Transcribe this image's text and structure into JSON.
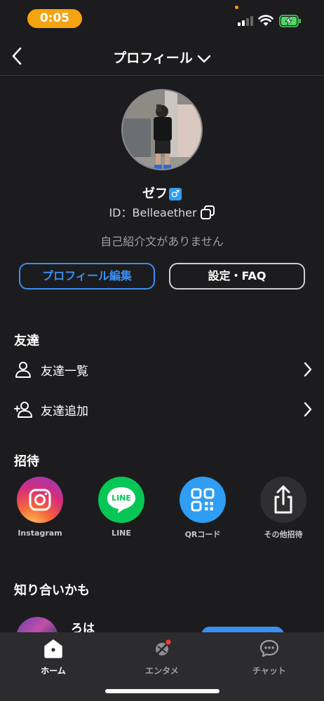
{
  "status_bar": {
    "time": "0:05"
  },
  "nav": {
    "title": "プロフィール"
  },
  "profile": {
    "name": "ゼフ",
    "gender_symbol": "♂",
    "id_text": "ID：Belleaether",
    "bio": "自己紹介文がありません",
    "edit_button": "プロフィール編集",
    "settings_button": "設定・FAQ"
  },
  "friends": {
    "title": "友達",
    "items": [
      {
        "label": "友達一覧",
        "icon": "person-icon"
      },
      {
        "label": "友達追加",
        "icon": "person-add-icon"
      }
    ]
  },
  "invite": {
    "title": "招待",
    "items": [
      {
        "label": "Instagram",
        "icon": "instagram-icon"
      },
      {
        "label": "LINE",
        "icon": "line-icon",
        "icon_text": "LINE"
      },
      {
        "label": "QRコード",
        "icon": "qr-code-icon"
      },
      {
        "label": "その他招待",
        "icon": "share-icon"
      }
    ]
  },
  "suggestions": {
    "title": "知り合いかも",
    "items": [
      {
        "name": "ろは"
      }
    ]
  },
  "tabbar": {
    "tabs": [
      {
        "label": "ホーム",
        "icon": "home-icon",
        "active": true
      },
      {
        "label": "エンタメ",
        "icon": "entertainment-icon",
        "active": false
      },
      {
        "label": "チャット",
        "icon": "chat-icon",
        "active": false
      }
    ]
  },
  "colors": {
    "background": "#1c1c1e",
    "accent": "#3b8ff2",
    "time_pill": "#f5a30f",
    "tabbar": "#2c2c2e"
  }
}
